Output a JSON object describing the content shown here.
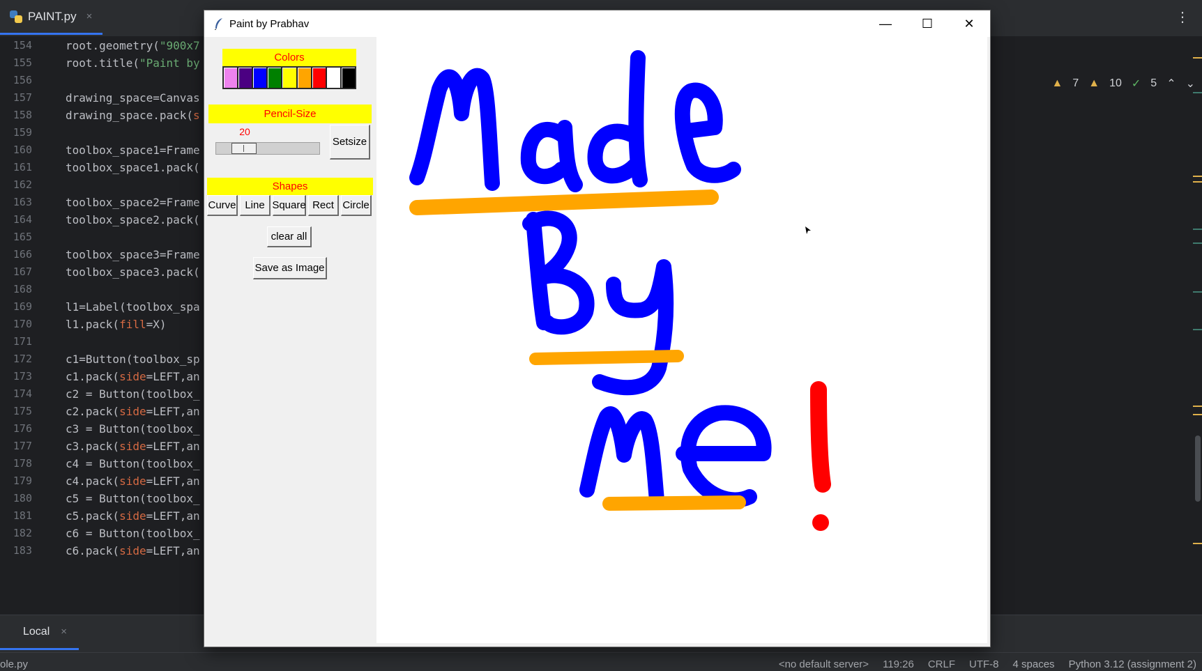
{
  "ide": {
    "file_tab": "PAINT.py",
    "tab_close": "×",
    "menu_dots": "⋮",
    "gutter": [
      "154",
      "155",
      "156",
      "157",
      "158",
      "159",
      "160",
      "161",
      "162",
      "163",
      "164",
      "165",
      "166",
      "167",
      "168",
      "169",
      "170",
      "171",
      "172",
      "173",
      "174",
      "175",
      "176",
      "177",
      "178",
      "179",
      "180",
      "181",
      "182",
      "183"
    ],
    "code": [
      {
        "a": "root.geometry(",
        "s": "\"900x7",
        "p": "",
        "r": ""
      },
      {
        "a": "root.title(",
        "s": "\"Paint by",
        "p": "",
        "r": ""
      },
      {
        "a": "",
        "s": "",
        "p": "",
        "r": ""
      },
      {
        "a": "drawing_space=Canvas",
        "s": "",
        "p": "",
        "r": ""
      },
      {
        "a": "drawing_space.pack(",
        "s": "",
        "p": "s",
        "r": ""
      },
      {
        "a": "",
        "s": "",
        "p": "",
        "r": ""
      },
      {
        "a": "toolbox_space1=Frame",
        "s": "",
        "p": "",
        "r": ""
      },
      {
        "a": "toolbox_space1.pack(",
        "s": "",
        "p": "",
        "r": ""
      },
      {
        "a": "",
        "s": "",
        "p": "",
        "r": ""
      },
      {
        "a": "toolbox_space2=Frame",
        "s": "",
        "p": "",
        "r": ""
      },
      {
        "a": "toolbox_space2.pack(",
        "s": "",
        "p": "",
        "r": ""
      },
      {
        "a": "",
        "s": "",
        "p": "",
        "r": ""
      },
      {
        "a": "toolbox_space3=Frame",
        "s": "",
        "p": "",
        "r": ""
      },
      {
        "a": "toolbox_space3.pack(",
        "s": "",
        "p": "",
        "r": ""
      },
      {
        "a": "",
        "s": "",
        "p": "",
        "r": ""
      },
      {
        "a": "l1=Label(toolbox_spa",
        "s": "",
        "p": "",
        "r": ""
      },
      {
        "a": "l1.pack(",
        "s": "",
        "p": "fill",
        "r": "=X)"
      },
      {
        "a": "",
        "s": "",
        "p": "",
        "r": ""
      },
      {
        "a": "c1=Button(toolbox_sp",
        "s": "",
        "p": "",
        "r": ""
      },
      {
        "a": "c1.pack(",
        "s": "",
        "p": "side",
        "r": "=LEFT,an"
      },
      {
        "a": "c2 = Button(toolbox_",
        "s": "",
        "p": "",
        "r": ""
      },
      {
        "a": "c2.pack(",
        "s": "",
        "p": "side",
        "r": "=LEFT,an"
      },
      {
        "a": "c3 = Button(toolbox_",
        "s": "",
        "p": "",
        "r": ""
      },
      {
        "a": "c3.pack(",
        "s": "",
        "p": "side",
        "r": "=LEFT,an"
      },
      {
        "a": "c4 = Button(toolbox_",
        "s": "",
        "p": "",
        "r": ""
      },
      {
        "a": "c4.pack(",
        "s": "",
        "p": "side",
        "r": "=LEFT,an"
      },
      {
        "a": "c5 = Button(toolbox_",
        "s": "",
        "p": "",
        "r": ""
      },
      {
        "a": "c5.pack(",
        "s": "",
        "p": "side",
        "r": "=LEFT,an"
      },
      {
        "a": "c6 = Button(toolbox_",
        "s": "",
        "p": "",
        "r": ""
      },
      {
        "a": "c6.pack(",
        "s": "",
        "p": "side",
        "r": "=LEFT,an"
      }
    ],
    "inspections": {
      "warnings_a": "7",
      "warnings_b": "10",
      "ok": "5"
    },
    "terminal_tab": "Local",
    "status": {
      "left": "ole.py",
      "server": "<no default server>",
      "position": "119:26",
      "line_sep": "CRLF",
      "encoding": "UTF-8",
      "indent": "4 spaces",
      "interpreter": "Python 3.12 (assignment 2)"
    }
  },
  "paint": {
    "window_title": "Paint by Prabhav",
    "minimize": "—",
    "maximize": "☐",
    "close": "✕",
    "colors_label": "Colors",
    "palette": [
      "#ee82ee",
      "#4b0082",
      "#0000ff",
      "#008000",
      "#ffff00",
      "#ffa500",
      "#ff0000",
      "#ffffff",
      "#000000"
    ],
    "pencil_label": "Pencil-Size",
    "pencil_value": "20",
    "pencil_fraction": 0.2,
    "setsize_label": "Setsize",
    "shapes_label": "Shapes",
    "shapes": [
      "Curve",
      "Line",
      "Square",
      "Rect",
      "Circle"
    ],
    "clear_label": "clear all",
    "save_label": "Save as Image"
  }
}
